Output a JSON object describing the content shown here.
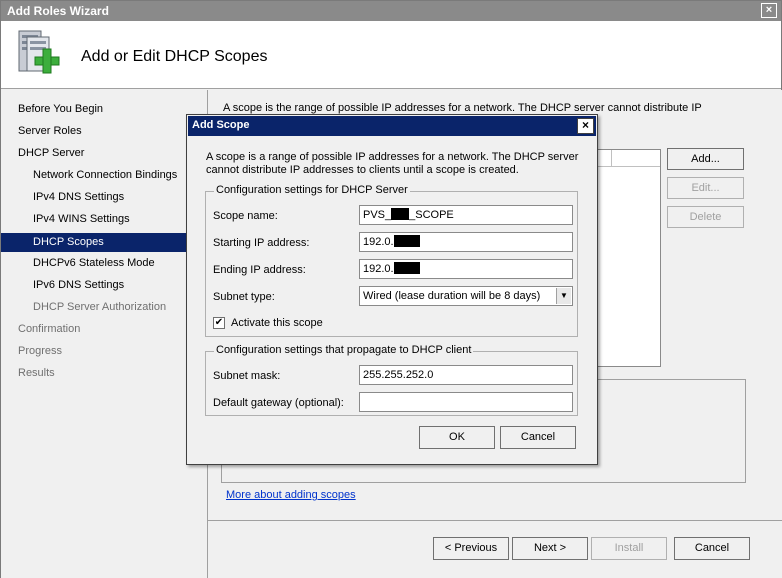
{
  "window": {
    "title": "Add Roles Wizard",
    "close_glyph": "×"
  },
  "header": {
    "title": "Add or Edit DHCP Scopes",
    "icon": "server-roles-add-icon"
  },
  "nav": {
    "items": [
      {
        "label": "Before You Begin",
        "state": "normal"
      },
      {
        "label": "Server Roles",
        "state": "normal"
      },
      {
        "label": "DHCP Server",
        "state": "normal"
      },
      {
        "label": "Network Connection Bindings",
        "state": "normal"
      },
      {
        "label": "IPv4 DNS Settings",
        "state": "normal"
      },
      {
        "label": "IPv4 WINS Settings",
        "state": "normal"
      },
      {
        "label": "DHCP Scopes",
        "state": "active"
      },
      {
        "label": "DHCPv6 Stateless Mode",
        "state": "normal"
      },
      {
        "label": "IPv6 DNS Settings",
        "state": "normal"
      },
      {
        "label": "DHCP Server Authorization",
        "state": "dim"
      },
      {
        "label": "Confirmation",
        "state": "dim"
      },
      {
        "label": "Progress",
        "state": "dim"
      },
      {
        "label": "Results",
        "state": "dim"
      }
    ]
  },
  "main": {
    "intro": "A scope is the range of possible IP addresses for a network. The DHCP server cannot distribute IP",
    "buttons": {
      "add": "Add...",
      "edit": "Edit...",
      "delete": "Delete"
    },
    "more_link": "More about adding scopes"
  },
  "footer": {
    "previous": "< Previous",
    "next": "Next >",
    "install": "Install",
    "cancel": "Cancel"
  },
  "dialog": {
    "title": "Add Scope",
    "close_glyph": "×",
    "description": "A scope is a range of possible IP addresses for a network. The DHCP server cannot distribute IP addresses to clients until a scope is created.",
    "server_group": {
      "legend": "Configuration settings for DHCP Server",
      "scope_name_label": "Scope name:",
      "scope_name_prefix": "PVS_",
      "scope_name_suffix": "_SCOPE",
      "start_ip_label": "Starting IP address:",
      "start_ip_prefix": "192.0.",
      "end_ip_label": "Ending IP address:",
      "end_ip_prefix": "192.0.",
      "subnet_type_label": "Subnet type:",
      "subnet_type_value": "Wired (lease duration will be 8 days)",
      "activate_label": "Activate this scope",
      "activate_checked": true,
      "checkbox_glyph": "✔",
      "dropdown_glyph": "▼"
    },
    "client_group": {
      "legend": "Configuration settings that propagate to DHCP client",
      "subnet_mask_label": "Subnet mask:",
      "subnet_mask_value": "255.255.252.0",
      "gateway_label": "Default gateway (optional):",
      "gateway_value": ""
    },
    "ok": "OK",
    "cancel": "Cancel"
  }
}
